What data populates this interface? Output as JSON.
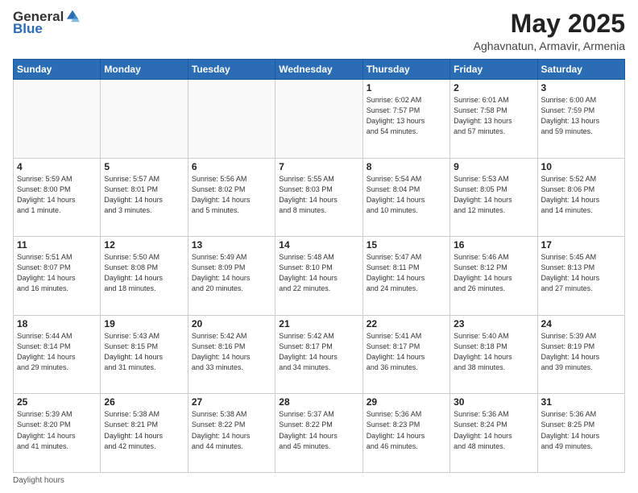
{
  "header": {
    "logo_general": "General",
    "logo_blue": "Blue",
    "month_title": "May 2025",
    "subtitle": "Aghavnatun, Armavir, Armenia"
  },
  "calendar": {
    "days_of_week": [
      "Sunday",
      "Monday",
      "Tuesday",
      "Wednesday",
      "Thursday",
      "Friday",
      "Saturday"
    ],
    "weeks": [
      [
        {
          "day": "",
          "info": ""
        },
        {
          "day": "",
          "info": ""
        },
        {
          "day": "",
          "info": ""
        },
        {
          "day": "",
          "info": ""
        },
        {
          "day": "1",
          "info": "Sunrise: 6:02 AM\nSunset: 7:57 PM\nDaylight: 13 hours\nand 54 minutes."
        },
        {
          "day": "2",
          "info": "Sunrise: 6:01 AM\nSunset: 7:58 PM\nDaylight: 13 hours\nand 57 minutes."
        },
        {
          "day": "3",
          "info": "Sunrise: 6:00 AM\nSunset: 7:59 PM\nDaylight: 13 hours\nand 59 minutes."
        }
      ],
      [
        {
          "day": "4",
          "info": "Sunrise: 5:59 AM\nSunset: 8:00 PM\nDaylight: 14 hours\nand 1 minute."
        },
        {
          "day": "5",
          "info": "Sunrise: 5:57 AM\nSunset: 8:01 PM\nDaylight: 14 hours\nand 3 minutes."
        },
        {
          "day": "6",
          "info": "Sunrise: 5:56 AM\nSunset: 8:02 PM\nDaylight: 14 hours\nand 5 minutes."
        },
        {
          "day": "7",
          "info": "Sunrise: 5:55 AM\nSunset: 8:03 PM\nDaylight: 14 hours\nand 8 minutes."
        },
        {
          "day": "8",
          "info": "Sunrise: 5:54 AM\nSunset: 8:04 PM\nDaylight: 14 hours\nand 10 minutes."
        },
        {
          "day": "9",
          "info": "Sunrise: 5:53 AM\nSunset: 8:05 PM\nDaylight: 14 hours\nand 12 minutes."
        },
        {
          "day": "10",
          "info": "Sunrise: 5:52 AM\nSunset: 8:06 PM\nDaylight: 14 hours\nand 14 minutes."
        }
      ],
      [
        {
          "day": "11",
          "info": "Sunrise: 5:51 AM\nSunset: 8:07 PM\nDaylight: 14 hours\nand 16 minutes."
        },
        {
          "day": "12",
          "info": "Sunrise: 5:50 AM\nSunset: 8:08 PM\nDaylight: 14 hours\nand 18 minutes."
        },
        {
          "day": "13",
          "info": "Sunrise: 5:49 AM\nSunset: 8:09 PM\nDaylight: 14 hours\nand 20 minutes."
        },
        {
          "day": "14",
          "info": "Sunrise: 5:48 AM\nSunset: 8:10 PM\nDaylight: 14 hours\nand 22 minutes."
        },
        {
          "day": "15",
          "info": "Sunrise: 5:47 AM\nSunset: 8:11 PM\nDaylight: 14 hours\nand 24 minutes."
        },
        {
          "day": "16",
          "info": "Sunrise: 5:46 AM\nSunset: 8:12 PM\nDaylight: 14 hours\nand 26 minutes."
        },
        {
          "day": "17",
          "info": "Sunrise: 5:45 AM\nSunset: 8:13 PM\nDaylight: 14 hours\nand 27 minutes."
        }
      ],
      [
        {
          "day": "18",
          "info": "Sunrise: 5:44 AM\nSunset: 8:14 PM\nDaylight: 14 hours\nand 29 minutes."
        },
        {
          "day": "19",
          "info": "Sunrise: 5:43 AM\nSunset: 8:15 PM\nDaylight: 14 hours\nand 31 minutes."
        },
        {
          "day": "20",
          "info": "Sunrise: 5:42 AM\nSunset: 8:16 PM\nDaylight: 14 hours\nand 33 minutes."
        },
        {
          "day": "21",
          "info": "Sunrise: 5:42 AM\nSunset: 8:17 PM\nDaylight: 14 hours\nand 34 minutes."
        },
        {
          "day": "22",
          "info": "Sunrise: 5:41 AM\nSunset: 8:17 PM\nDaylight: 14 hours\nand 36 minutes."
        },
        {
          "day": "23",
          "info": "Sunrise: 5:40 AM\nSunset: 8:18 PM\nDaylight: 14 hours\nand 38 minutes."
        },
        {
          "day": "24",
          "info": "Sunrise: 5:39 AM\nSunset: 8:19 PM\nDaylight: 14 hours\nand 39 minutes."
        }
      ],
      [
        {
          "day": "25",
          "info": "Sunrise: 5:39 AM\nSunset: 8:20 PM\nDaylight: 14 hours\nand 41 minutes."
        },
        {
          "day": "26",
          "info": "Sunrise: 5:38 AM\nSunset: 8:21 PM\nDaylight: 14 hours\nand 42 minutes."
        },
        {
          "day": "27",
          "info": "Sunrise: 5:38 AM\nSunset: 8:22 PM\nDaylight: 14 hours\nand 44 minutes."
        },
        {
          "day": "28",
          "info": "Sunrise: 5:37 AM\nSunset: 8:22 PM\nDaylight: 14 hours\nand 45 minutes."
        },
        {
          "day": "29",
          "info": "Sunrise: 5:36 AM\nSunset: 8:23 PM\nDaylight: 14 hours\nand 46 minutes."
        },
        {
          "day": "30",
          "info": "Sunrise: 5:36 AM\nSunset: 8:24 PM\nDaylight: 14 hours\nand 48 minutes."
        },
        {
          "day": "31",
          "info": "Sunrise: 5:36 AM\nSunset: 8:25 PM\nDaylight: 14 hours\nand 49 minutes."
        }
      ]
    ]
  },
  "footer": {
    "note": "Daylight hours"
  }
}
